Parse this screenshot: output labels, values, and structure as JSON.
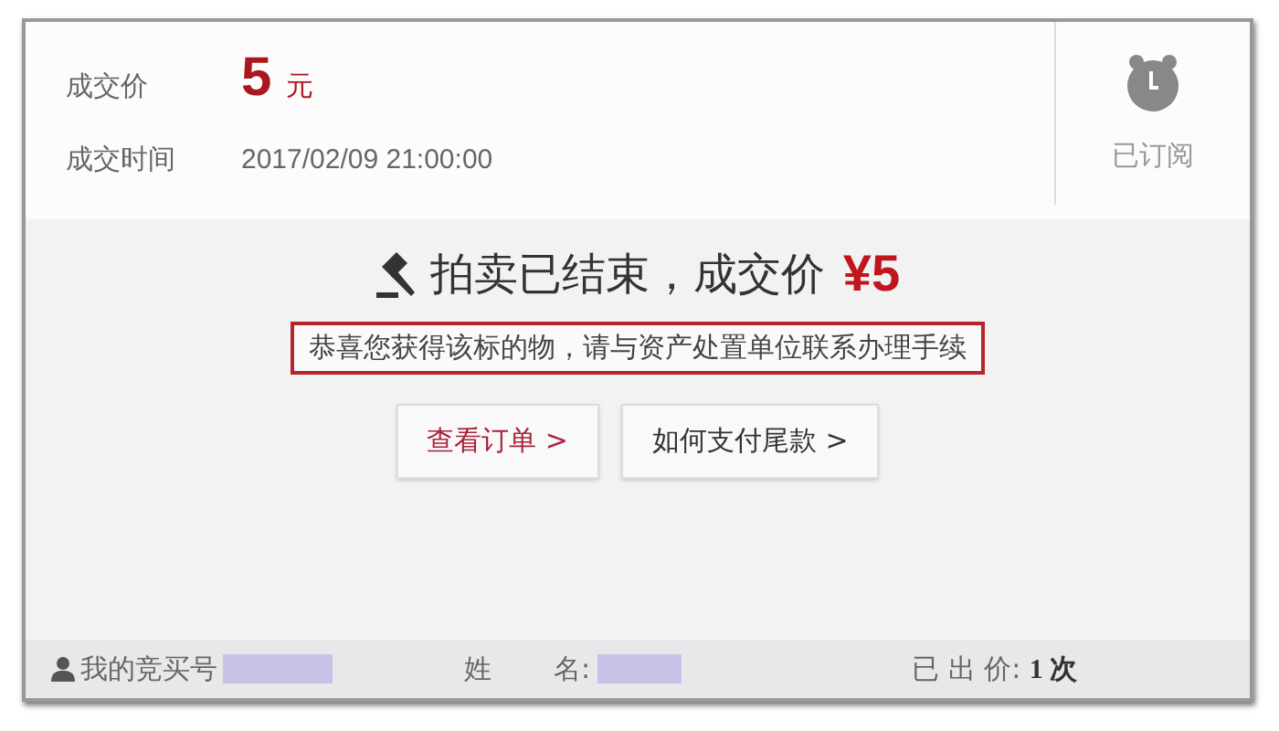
{
  "deal": {
    "price_label": "成交价",
    "price": "5",
    "price_unit": "元",
    "time_label": "成交时间",
    "time": "2017/02/09 21:00:00"
  },
  "subscribe": {
    "label": "已订阅"
  },
  "result": {
    "title": "拍卖已结束，成交价",
    "price": "¥5",
    "notice": "恭喜您获得该标的物，请与资产处置单位联系办理手续"
  },
  "buttons": [
    {
      "label": "查看订单 >",
      "kind": "primary"
    },
    {
      "label": "如何支付尾款 >",
      "kind": "secondary"
    }
  ],
  "footer": {
    "bid_number_label": "我的竞买号",
    "name_label_1": "姓",
    "name_label_2": "名:",
    "bids": "已 出 价: **1 次**"
  }
}
